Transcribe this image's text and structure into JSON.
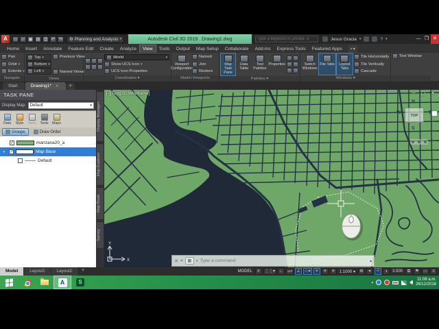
{
  "title_bar": {
    "workspace": "Planning and Analysis",
    "app_title": "Autodesk Civil 3D 2019",
    "document": "Drawing1.dwg",
    "search_placeholder": "Type a keyword or phrase",
    "user": "Jesus Gracia"
  },
  "ribbon": {
    "tabs": [
      "Home",
      "Insert",
      "Annotate",
      "Feature Edit",
      "Create",
      "Analyze",
      "View",
      "Tools",
      "Output",
      "Map Setup",
      "Collaborate",
      "Add-ins",
      "Express Tools",
      "Featured Apps"
    ],
    "active_tab": "View",
    "navigate": {
      "label": "Navigate",
      "pan": "Pan",
      "orbit": "Orbit",
      "extents": "Extents"
    },
    "views": {
      "label": "Views",
      "top": "Top",
      "bottom": "Bottom",
      "left": "Left",
      "previous": "Previous View",
      "named": "Named Views"
    },
    "coordinates": {
      "label": "Coordinates",
      "world": "World",
      "show_ucs": "Show UCS Icon",
      "ucs_props": "UCS Icon Properties"
    },
    "model_viewports": {
      "label": "Model Viewports",
      "config": "Viewport Configuration",
      "named": "Named",
      "join": "Join",
      "restore": "Restore"
    },
    "palettes": {
      "label": "Palettes",
      "map_task_pane": "Map Task Pane",
      "data_table": "Data Table",
      "tool_palettes": "Tool Palettes",
      "properties": "Properties"
    },
    "windows": {
      "label": "Windows",
      "switch": "Switch Windows",
      "file_tabs": "File Tabs",
      "layout_tabs": "Layout Tabs",
      "tile_h": "Tile Horizontally",
      "tile_v": "Tile Vertically",
      "cascade": "Cascade"
    },
    "text_window": "Text Window"
  },
  "file_tabs": {
    "start": "Start",
    "drawing": "Drawing1*",
    "close_glyph": "✕",
    "add_glyph": "+"
  },
  "task_pane": {
    "title": "TASK PANE",
    "display_map_label": "Display Map:",
    "display_map_value": "Default",
    "tools": [
      "Data",
      "Style",
      "Table",
      "Tools",
      "Maps"
    ],
    "tab_groups": "Groups",
    "tab_draw_order": "Draw Order",
    "layers": [
      {
        "name": "manzana20_a",
        "checked": "✓"
      },
      {
        "name": "Map Base",
        "checked": "✓"
      },
      {
        "name": "Default",
        "checked": ""
      }
    ],
    "side_tabs": [
      "Display Manager",
      "Map Explorer",
      "Map Book",
      "Survey"
    ]
  },
  "viewport": {
    "label": "[-][Top][2D Wireframe]",
    "viewcube": {
      "top": "TOP",
      "n": "N",
      "s": "S",
      "e": "E",
      "w": "W"
    }
  },
  "command_line": {
    "placeholder": "Type a command"
  },
  "layout_tabs": {
    "model": "Model",
    "layout1": "Layout1",
    "layout2": "Layout2",
    "add_glyph": "+"
  },
  "status_bar": {
    "model_label": "MODEL",
    "annotation_scale": "1:1000",
    "value": "3.500"
  },
  "taskbar": {
    "clock_time": "11:08 a.m.",
    "clock_date": "26/12/2018"
  },
  "colors": {
    "map_land_green": "#6fa768",
    "map_dark": "#232d3a",
    "selection_blue": "#2f7fd6",
    "title_green": "#6fc096",
    "taskbar_green": "#23904a",
    "layer_swatch_green": "#7db374"
  }
}
